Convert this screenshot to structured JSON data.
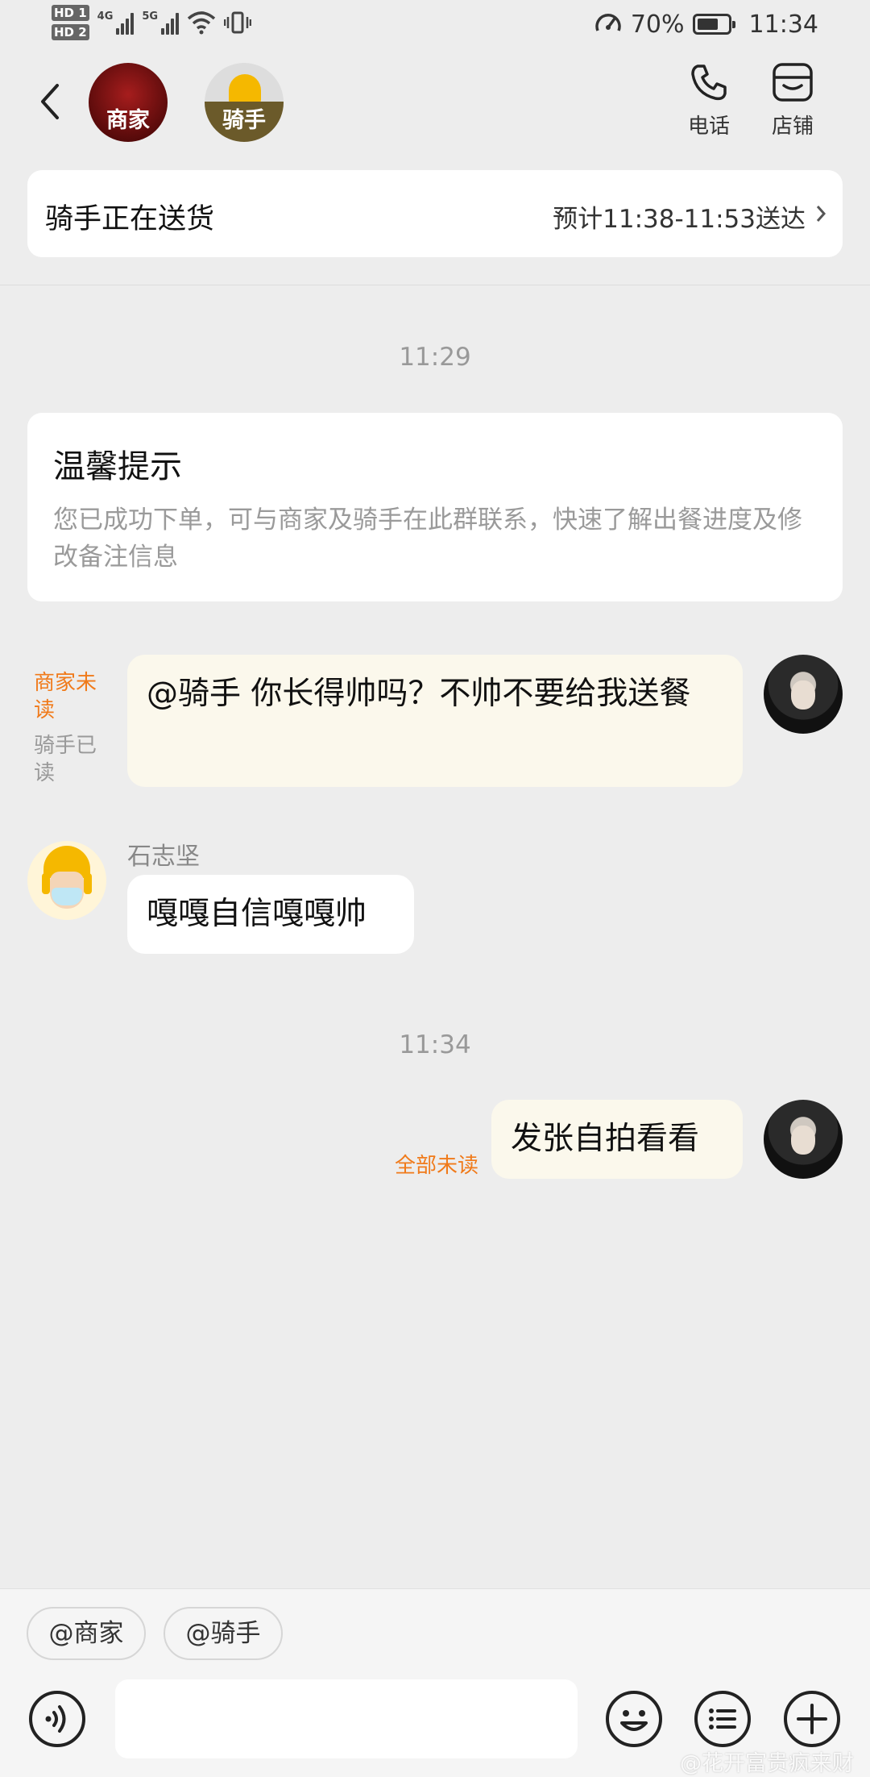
{
  "status_bar": {
    "hd1": "HD 1",
    "hd2": "HD 2",
    "net1": "4G",
    "net2": "5G",
    "battery": "70%",
    "time": "11:34"
  },
  "header": {
    "merchant_label": "商家",
    "rider_label": "骑手",
    "call_label": "电话",
    "shop_label": "店铺"
  },
  "delivery": {
    "status": "骑手正在送货",
    "eta": "预计11:38-11:53送达"
  },
  "chat": {
    "time1": "11:29",
    "tip_title": "温馨提示",
    "tip_body": "您已成功下单，可与商家及骑手在此群联系，快速了解出餐进度及修改备注信息",
    "msg1": {
      "text": "@骑手 你长得帅吗？不帅不要给我送餐",
      "status_merchant": "商家未读",
      "status_rider": "骑手已读"
    },
    "msg2": {
      "sender": "石志坚",
      "text": "嘎嘎自信嘎嘎帅"
    },
    "time2": "11:34",
    "msg3": {
      "text": "发张自拍看看",
      "status": "全部未读"
    }
  },
  "bottom": {
    "chip_merchant": "@商家",
    "chip_rider": "@骑手",
    "input_value": ""
  },
  "watermark": "@花开富贵疯来财",
  "colors": {
    "accent_orange": "#f07a1a",
    "background": "#ededed",
    "outgoing_bubble": "#fbf8ec"
  },
  "icons": [
    "back-icon",
    "phone-icon",
    "store-icon",
    "voice-icon",
    "emoji-icon",
    "list-icon",
    "add-icon",
    "chevron-right-icon"
  ]
}
